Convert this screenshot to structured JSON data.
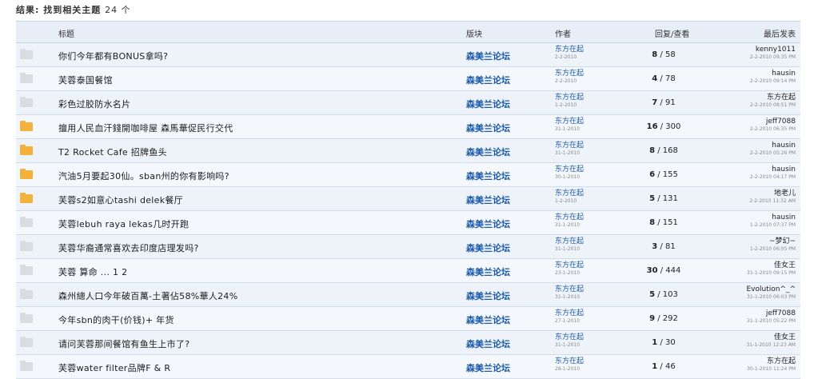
{
  "result": {
    "label": "结果: 找到相关主题",
    "count": "24 个"
  },
  "header": {
    "title": "标题",
    "forum": "版块",
    "author": "作者",
    "stats": "回复/查看",
    "last": "最后发表"
  },
  "rows": [
    {
      "icon": "normal",
      "title": "你们今年都有BONUS拿吗?",
      "forum": "森美兰论坛",
      "author": "东方在起",
      "author_date": "2-2-2010",
      "replies": "8",
      "views": "58",
      "last_user": "kenny1011",
      "last_date": "2-2-2010 09:35 PM"
    },
    {
      "icon": "normal",
      "title": "芙蓉泰国餐馆",
      "forum": "森美兰论坛",
      "author": "东方在起",
      "author_date": "2-2-2010",
      "replies": "4",
      "views": "78",
      "last_user": "hausin",
      "last_date": "2-2-2010 09:14 PM"
    },
    {
      "icon": "normal",
      "title": "彩色过胶防水名片",
      "forum": "森美兰论坛",
      "author": "东方在起",
      "author_date": "1-2-2010",
      "replies": "7",
      "views": "91",
      "last_user": "东方在起",
      "last_date": "2-2-2010 08:51 PM"
    },
    {
      "icon": "hot",
      "title": "擅用人民血汗錢開咖啡屋 森馬華促民行交代",
      "forum": "森美兰论坛",
      "author": "东方在起",
      "author_date": "31-1-2010",
      "replies": "16",
      "views": "300",
      "last_user": "jeff7088",
      "last_date": "2-2-2010 06:35 PM"
    },
    {
      "icon": "hot",
      "title": "T2 Rocket Cafe 招牌鱼头",
      "forum": "森美兰论坛",
      "author": "东方在起",
      "author_date": "31-1-2010",
      "replies": "8",
      "views": "168",
      "last_user": "hausin",
      "last_date": "2-2-2010 05:26 PM"
    },
    {
      "icon": "hot",
      "title": "汽油5月要起30仙。sban州的你有影响吗?",
      "forum": "森美兰论坛",
      "author": "东方在起",
      "author_date": "30-1-2010",
      "replies": "6",
      "views": "155",
      "last_user": "hausin",
      "last_date": "2-2-2010 04:17 PM"
    },
    {
      "icon": "hot",
      "title": "芙蓉s2如意心tashi delek餐厅",
      "forum": "森美兰论坛",
      "author": "东方在起",
      "author_date": "1-2-2010",
      "replies": "5",
      "views": "131",
      "last_user": "地老儿",
      "last_date": "2-2-2010 11:32 AM"
    },
    {
      "icon": "normal",
      "title": "芙蓉lebuh raya lekas几时开跑",
      "forum": "森美兰论坛",
      "author": "东方在起",
      "author_date": "31-1-2010",
      "replies": "8",
      "views": "151",
      "last_user": "hausin",
      "last_date": "1-2-2010 07:37 PM"
    },
    {
      "icon": "normal",
      "title": "芙蓉华裔通常喜欢去印度店理发吗?",
      "forum": "森美兰论坛",
      "author": "东方在起",
      "author_date": "31-1-2010",
      "replies": "3",
      "views": "81",
      "last_user": "~梦幻~",
      "last_date": "1-2-2010 06:05 PM"
    },
    {
      "icon": "normal",
      "title": "芙蓉 算命 ...  1  2",
      "forum": "森美兰论坛",
      "author": "东方在起",
      "author_date": "23-1-2010",
      "replies": "30",
      "views": "444",
      "last_user": "佳女王",
      "last_date": "31-1-2010 09:15 PM"
    },
    {
      "icon": "normal",
      "title": "森州總人口今年破百萬-土著佔58%華人24%",
      "forum": "森美兰论坛",
      "author": "东方在起",
      "author_date": "31-1-2010",
      "replies": "5",
      "views": "103",
      "last_user": "Evolution^_^",
      "last_date": "31-1-2010 06:03 PM"
    },
    {
      "icon": "normal",
      "title": "今年sbn的肉干(价钱)+ 年货",
      "forum": "森美兰论坛",
      "author": "东方在起",
      "author_date": "27-1-2010",
      "replies": "9",
      "views": "292",
      "last_user": "jeff7088",
      "last_date": "31-1-2010 05:22 PM"
    },
    {
      "icon": "normal",
      "title": "请问芙蓉那间餐馆有鱼生上市了?",
      "forum": "森美兰论坛",
      "author": "东方在起",
      "author_date": "31-1-2010",
      "replies": "1",
      "views": "30",
      "last_user": "佳女王",
      "last_date": "31-1-2010 12:23 AM"
    },
    {
      "icon": "normal",
      "title": "芙蓉water filter品牌F & R",
      "forum": "森美兰论坛",
      "author": "东方在起",
      "author_date": "28-1-2010",
      "replies": "1",
      "views": "46",
      "last_user": "东方在起",
      "last_date": "30-1-2010 11:24 PM"
    }
  ]
}
